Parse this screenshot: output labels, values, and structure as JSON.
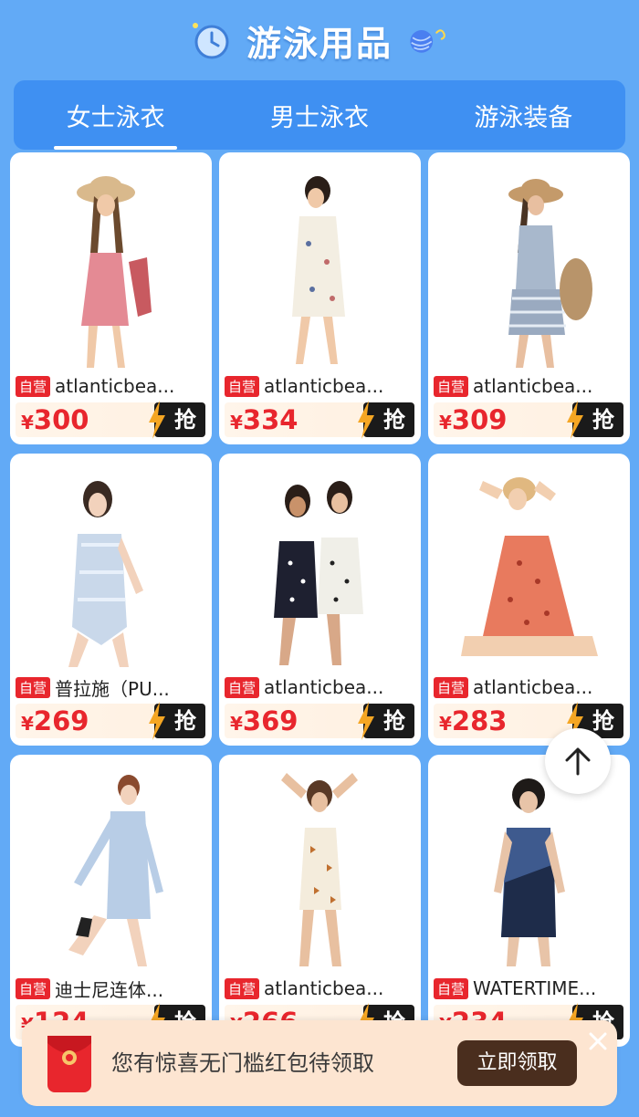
{
  "header": {
    "title": "游泳用品"
  },
  "tabs": [
    {
      "label": "女士泳衣",
      "active": true
    },
    {
      "label": "男士泳衣",
      "active": false
    },
    {
      "label": "游泳装备",
      "active": false
    }
  ],
  "products": [
    {
      "tag": "自营",
      "name": "atlanticbea...",
      "currency": "¥",
      "price": "300",
      "grab": "抢"
    },
    {
      "tag": "自营",
      "name": "atlanticbea...",
      "currency": "¥",
      "price": "334",
      "grab": "抢"
    },
    {
      "tag": "自营",
      "name": "atlanticbea...",
      "currency": "¥",
      "price": "309",
      "grab": "抢"
    },
    {
      "tag": "自营",
      "name": "普拉施（PU...",
      "currency": "¥",
      "price": "269",
      "grab": "抢"
    },
    {
      "tag": "自营",
      "name": "atlanticbea...",
      "currency": "¥",
      "price": "369",
      "grab": "抢"
    },
    {
      "tag": "自营",
      "name": "atlanticbea...",
      "currency": "¥",
      "price": "283",
      "grab": "抢"
    },
    {
      "tag": "自营",
      "name": "迪士尼连体...",
      "currency": "¥",
      "price": "124",
      "grab": "抢"
    },
    {
      "tag": "自营",
      "name": "atlanticbea...",
      "currency": "¥",
      "price": "266",
      "grab": "抢"
    },
    {
      "tag": "自营",
      "name": "WATERTIME...",
      "currency": "¥",
      "price": "234",
      "grab": "抢"
    }
  ],
  "banner": {
    "text": "您有惊喜无门槛红包待领取",
    "button": "立即领取"
  },
  "colors": {
    "background": "#62aaf6",
    "tabs": "#3f90f2",
    "price": "#e8262d",
    "banner": "#fde5d1"
  },
  "icons": {
    "back_to_top": "arrow-up-icon",
    "close": "close-icon",
    "red_packet": "red-packet-icon"
  }
}
